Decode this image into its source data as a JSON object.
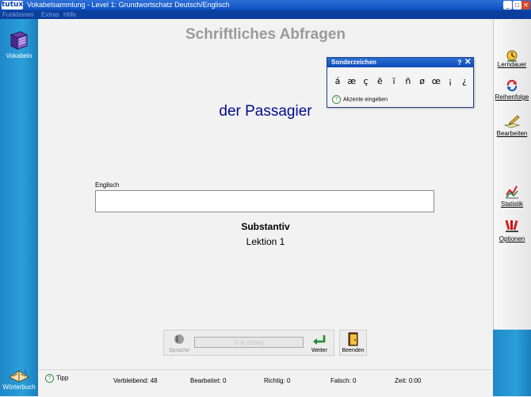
{
  "window": {
    "logo": "tutux",
    "title": "Vokabelsammlung - Level 1: Grundwortschatz Deutsch/Englisch"
  },
  "menu": [
    "Funktionen",
    "Extras",
    "Hilfe"
  ],
  "left_sidebar": {
    "vokabeln": "Vokabeln",
    "woerterbuch": "Wörterbuch"
  },
  "right_sidebar": {
    "lerndauer": "Lerndauer",
    "reihenfolge": "Reihenfolge",
    "bearbeiten": "Bearbeiten",
    "statistik": "Statistik",
    "optionen": "Optionen"
  },
  "main": {
    "title": "Schriftliches Abfragen",
    "question": "der Passagier",
    "answer_label": "Englisch",
    "answer_value": "",
    "word_type": "Substantiv",
    "lesson": "Lektion 1"
  },
  "special_chars": {
    "title": "Sonderzeichen",
    "help": "?",
    "close": "✕",
    "chars": [
      "á",
      "æ",
      "ç",
      "ë",
      "ï",
      "ñ",
      "ø",
      "œ",
      "¡",
      "¿"
    ],
    "accent_link": "Akzente eingeben"
  },
  "controls": {
    "speech": "Sprache",
    "progress": "0 % richtig",
    "next": "Weiter",
    "end": "Beenden"
  },
  "status": {
    "tip": "Tipp",
    "remaining_label": "Verbleibend:",
    "remaining": "48",
    "edited_label": "Bearbeitet:",
    "edited": "0",
    "correct_label": "Richtig:",
    "correct": "0",
    "wrong_label": "Falsch:",
    "wrong": "0",
    "time_label": "Zeit:",
    "time": "0:00"
  },
  "colors": {
    "titlebar": "#0b4fc2",
    "sidebar_blue": "#2b9fd9",
    "question_text": "#000c8c",
    "title_gray": "#9a9a9a"
  }
}
